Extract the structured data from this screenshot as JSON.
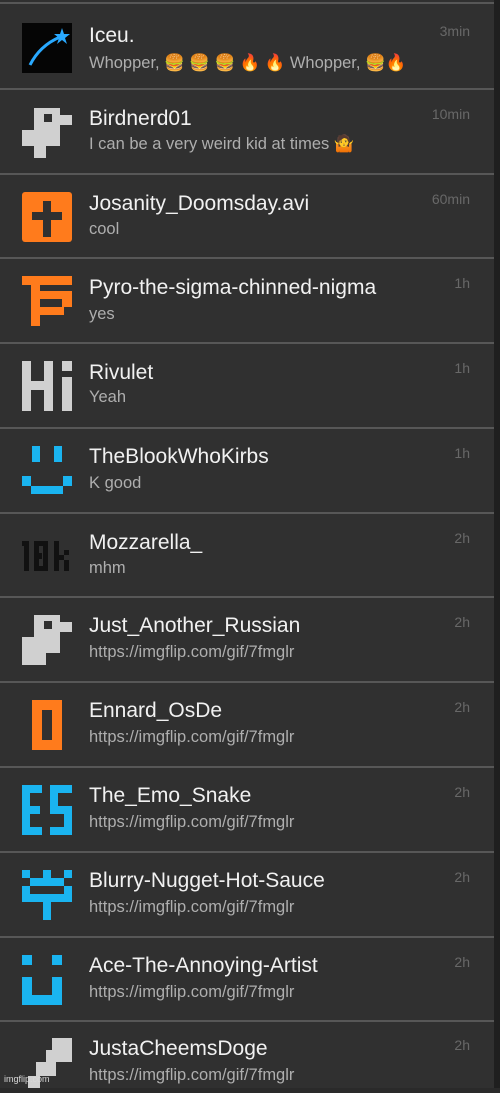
{
  "conversations": [
    {
      "name": "Iceu.",
      "message": "Whopper, 🍔 🍔 🍔 🔥 🔥 Whopper, 🍔🔥",
      "time": "3min",
      "avatar": "shooting-star-avatar",
      "color": "#29a9ff"
    },
    {
      "name": "Birdnerd01",
      "message": "I can be a very weird kid at times 🤷",
      "time": "10min",
      "avatar": "gray-pixel-avatar",
      "color": "#d0d0d0"
    },
    {
      "name": "Josanity_Doomsday.avi",
      "message": "cool",
      "time": "60min",
      "avatar": "orange-cross-avatar",
      "color": "#ff7b1c"
    },
    {
      "name": "Pyro-the-sigma-chinned-nigma",
      "message": "yes",
      "time": "1h",
      "avatar": "orange-pf-avatar",
      "color": "#ff7b1c"
    },
    {
      "name": "Rivulet",
      "message": "Yeah",
      "time": "1h",
      "avatar": "hi-avatar",
      "color": "#d0d0d0"
    },
    {
      "name": "TheBlookWhoKirbs",
      "message": "K good",
      "time": "1h",
      "avatar": "smiley-avatar",
      "color": "#1ab4f0"
    },
    {
      "name": "Mozzarella_",
      "message": "mhm",
      "time": "2h",
      "avatar": "10k-avatar",
      "color": "#111111"
    },
    {
      "name": "Just_Another_Russian",
      "message": "https://imgflip.com/gif/7fmglr",
      "time": "2h",
      "avatar": "gray-pixel-avatar",
      "color": "#d0d0d0"
    },
    {
      "name": "Ennard_OsDe",
      "message": "https://imgflip.com/gif/7fmglr",
      "time": "2h",
      "avatar": "orange-o-avatar",
      "color": "#ff7b1c"
    },
    {
      "name": "The_Emo_Snake",
      "message": "https://imgflip.com/gif/7fmglr",
      "time": "2h",
      "avatar": "es-avatar",
      "color": "#1ab4f0"
    },
    {
      "name": "Blurry-Nugget-Hot-Sauce",
      "message": "https://imgflip.com/gif/7fmglr",
      "time": "2h",
      "avatar": "cyan-pattern-avatar",
      "color": "#1ab4f0"
    },
    {
      "name": "Ace-The-Annoying-Artist",
      "message": "https://imgflip.com/gif/7fmglr",
      "time": "2h",
      "avatar": "cyan-face-avatar",
      "color": "#1ab4f0"
    },
    {
      "name": "JustaCheemsDoge",
      "message": "https://imgflip.com/gif/7fmglr",
      "time": "2h",
      "avatar": "gray-stairs-avatar",
      "color": "#d0d0d0"
    }
  ],
  "watermark": "imgflip.com"
}
